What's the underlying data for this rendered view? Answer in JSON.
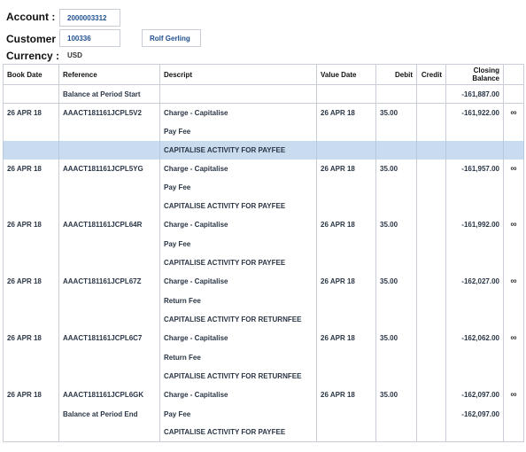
{
  "header": {
    "account_label": "Account :",
    "account_value": "2000003312",
    "customer_label": "Customer :",
    "customer_value": "100336",
    "customer_name": "Rolf Gerling",
    "currency_label": "Currency :",
    "currency_value": "USD"
  },
  "table": {
    "columns": [
      "Book Date",
      "Reference",
      "Descript",
      "Value Date",
      "Debit",
      "Credit",
      "Closing Balance"
    ],
    "period_start": {
      "label": "Balance at Period Start",
      "balance": "-161,887.00"
    },
    "period_end": {
      "label": "Balance at Period End",
      "balance": "-162,097.00"
    },
    "entries": [
      {
        "book_date": "26 APR 18",
        "reference": "AAACT181161JCPL5V2",
        "desc1": "Charge - Capitalise",
        "desc2": "Pay Fee",
        "desc3": "CAPITALISE ACTIVITY FOR PAYFEE",
        "value_date": "26 APR 18",
        "debit": "35.00",
        "credit": "",
        "balance": "-161,922.00",
        "icon": "chain-link-icon"
      },
      {
        "book_date": "26 APR 18",
        "reference": "AAACT181161JCPL5YG",
        "desc1": "Charge - Capitalise",
        "desc2": "Pay Fee",
        "desc3": "CAPITALISE ACTIVITY FOR PAYFEE",
        "value_date": "26 APR 18",
        "debit": "35.00",
        "credit": "",
        "balance": "-161,957.00",
        "icon": "chain-link-icon"
      },
      {
        "book_date": "26 APR 18",
        "reference": "AAACT181161JCPL64R",
        "desc1": "Charge - Capitalise",
        "desc2": "Pay Fee",
        "desc3": "CAPITALISE ACTIVITY FOR PAYFEE",
        "value_date": "26 APR 18",
        "debit": "35.00",
        "credit": "",
        "balance": "-161,992.00",
        "icon": "chain-link-icon"
      },
      {
        "book_date": "26 APR 18",
        "reference": "AAACT181161JCPL67Z",
        "desc1": "Charge - Capitalise",
        "desc2": "Return Fee",
        "desc3": "CAPITALISE ACTIVITY FOR RETURNFEE",
        "value_date": "26 APR 18",
        "debit": "35.00",
        "credit": "",
        "balance": "-162,027.00",
        "icon": "chain-link-icon"
      },
      {
        "book_date": "26 APR 18",
        "reference": "AAACT181161JCPL6C7",
        "desc1": "Charge - Capitalise",
        "desc2": "Return Fee",
        "desc3": "CAPITALISE ACTIVITY FOR RETURNFEE",
        "value_date": "26 APR 18",
        "debit": "35.00",
        "credit": "",
        "balance": "-162,062.00",
        "icon": "chain-link-icon"
      },
      {
        "book_date": "26 APR 18",
        "reference": "AAACT181161JCPL6GK",
        "desc1": "Charge - Capitalise",
        "desc2": "Pay Fee",
        "desc3": "CAPITALISE ACTIVITY FOR PAYFEE",
        "value_date": "26 APR 18",
        "debit": "35.00",
        "credit": "",
        "balance": "-162,097.00",
        "icon": "chain-link-icon"
      }
    ]
  },
  "icon_glyph": "∞",
  "colors": {
    "highlight_row": "#c9dbef",
    "link_text": "#1f4f8f"
  }
}
